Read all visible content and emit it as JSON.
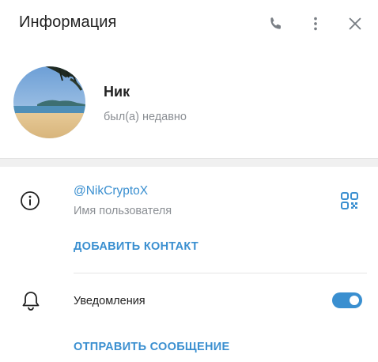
{
  "header": {
    "title": "Информация",
    "icons": [
      "phone-icon",
      "more-vertical-icon",
      "close-icon"
    ]
  },
  "profile": {
    "name": "Ник",
    "status": "был(а) недавно"
  },
  "info": {
    "username": "@NikCryptoX",
    "username_label": "Имя пользователя",
    "add_contact": "ДОБАВИТЬ КОНТАКТ"
  },
  "notifications": {
    "label": "Уведомления",
    "enabled": true
  },
  "actions": {
    "send_message": "ОТПРАВИТЬ СООБЩЕНИЕ"
  },
  "colors": {
    "accent": "#3a8fd0",
    "muted_text": "#8b8f94",
    "icon": "#7a7f85"
  }
}
